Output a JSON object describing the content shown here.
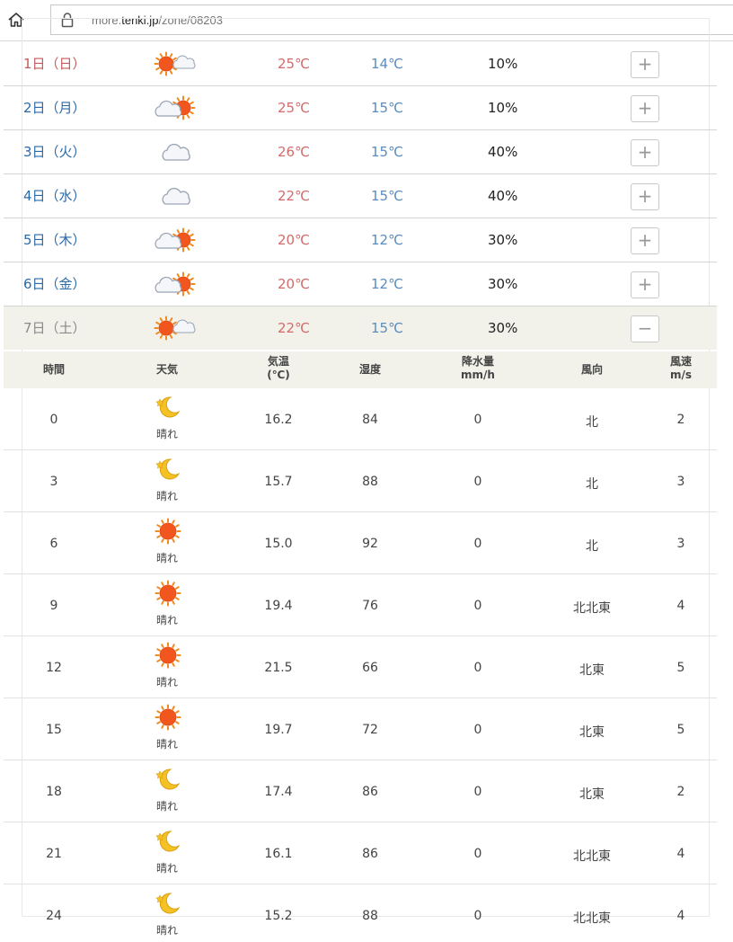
{
  "browser": {
    "url_prefix": "more.",
    "url_domain": "tenki.jp",
    "url_path": "/zone/08203"
  },
  "colors": {
    "sunday": "#c45a5a",
    "weekday": "#2a6aa8",
    "saturday": "#8a8a8a",
    "high_temp": "#d36b6b",
    "low_temp": "#5a8cbf",
    "expanded_bg": "#f2f2eb"
  },
  "daily": [
    {
      "date": "1日（日）",
      "icon": "sun-cloud-icon",
      "high": "25℃",
      "low": "14℃",
      "pop": "10%",
      "toggle": "+"
    },
    {
      "date": "2日（月）",
      "icon": "cloud-sun-icon",
      "high": "25℃",
      "low": "15℃",
      "pop": "10%",
      "toggle": "+"
    },
    {
      "date": "3日（火）",
      "icon": "cloud-icon",
      "high": "26℃",
      "low": "15℃",
      "pop": "40%",
      "toggle": "+"
    },
    {
      "date": "4日（水）",
      "icon": "cloud-icon",
      "high": "22℃",
      "low": "15℃",
      "pop": "40%",
      "toggle": "+"
    },
    {
      "date": "5日（木）",
      "icon": "cloud-sun-icon",
      "high": "20℃",
      "low": "12℃",
      "pop": "30%",
      "toggle": "+"
    },
    {
      "date": "6日（金）",
      "icon": "cloud-sun-icon",
      "high": "20℃",
      "low": "12℃",
      "pop": "30%",
      "toggle": "+"
    },
    {
      "date": "7日（土）",
      "icon": "sun-cloud-icon",
      "high": "22℃",
      "low": "15℃",
      "pop": "30%",
      "toggle": "−"
    }
  ],
  "hourly_header": {
    "time": "時間",
    "weather": "天気",
    "temp_1": "気温",
    "temp_2": "(℃)",
    "humidity": "湿度",
    "precip_1": "降水量",
    "precip_2": "mm/h",
    "wind_dir": "風向",
    "wind_spd_1": "風速",
    "wind_spd_2": "m/s"
  },
  "hourly": [
    {
      "time": "0",
      "icon": "moon-icon",
      "weather": "晴れ",
      "temp": "16.2",
      "humidity": "84",
      "precip": "0",
      "wind_dir": "北",
      "wind_spd": "2"
    },
    {
      "time": "3",
      "icon": "moon-icon",
      "weather": "晴れ",
      "temp": "15.7",
      "humidity": "88",
      "precip": "0",
      "wind_dir": "北",
      "wind_spd": "3"
    },
    {
      "time": "6",
      "icon": "sun-icon",
      "weather": "晴れ",
      "temp": "15.0",
      "humidity": "92",
      "precip": "0",
      "wind_dir": "北",
      "wind_spd": "3"
    },
    {
      "time": "9",
      "icon": "sun-icon",
      "weather": "晴れ",
      "temp": "19.4",
      "humidity": "76",
      "precip": "0",
      "wind_dir": "北北東",
      "wind_spd": "4"
    },
    {
      "time": "12",
      "icon": "sun-icon",
      "weather": "晴れ",
      "temp": "21.5",
      "humidity": "66",
      "precip": "0",
      "wind_dir": "北東",
      "wind_spd": "5"
    },
    {
      "time": "15",
      "icon": "sun-icon",
      "weather": "晴れ",
      "temp": "19.7",
      "humidity": "72",
      "precip": "0",
      "wind_dir": "北東",
      "wind_spd": "5"
    },
    {
      "time": "18",
      "icon": "moon-icon",
      "weather": "晴れ",
      "temp": "17.4",
      "humidity": "86",
      "precip": "0",
      "wind_dir": "北東",
      "wind_spd": "2"
    },
    {
      "time": "21",
      "icon": "moon-icon",
      "weather": "晴れ",
      "temp": "16.1",
      "humidity": "86",
      "precip": "0",
      "wind_dir": "北北東",
      "wind_spd": "4"
    },
    {
      "time": "24",
      "icon": "moon-icon",
      "weather": "晴れ",
      "temp": "15.2",
      "humidity": "88",
      "precip": "0",
      "wind_dir": "北北東",
      "wind_spd": "4"
    }
  ]
}
